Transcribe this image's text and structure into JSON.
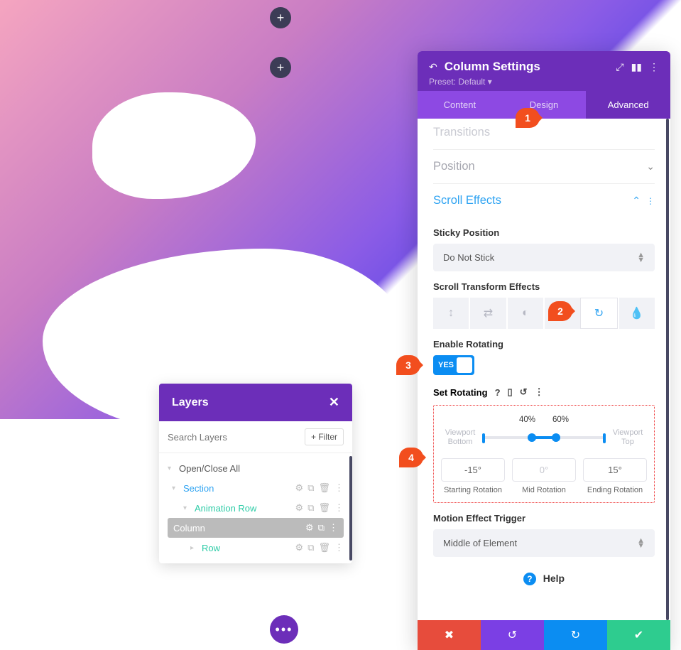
{
  "canvas": {
    "add_button": "+"
  },
  "layers": {
    "title": "Layers",
    "close": "✕",
    "search_placeholder": "Search Layers",
    "filter_label": "+ Filter",
    "open_close_all": "Open/Close All",
    "items": [
      {
        "label": "Section",
        "level": 1,
        "color": "blue"
      },
      {
        "label": "Animation Row",
        "level": 2,
        "color": "teal"
      },
      {
        "label": "Column",
        "level": 3,
        "color": "active"
      },
      {
        "label": "Row",
        "level": 3,
        "color": "teal"
      }
    ]
  },
  "settings": {
    "back": "↶",
    "title": "Column Settings",
    "preset_label": "Preset: Default",
    "preset_caret": "▾",
    "header_icons": {
      "expand": "⤢",
      "page": "▮▮",
      "more": "⋮"
    },
    "tabs": {
      "content": "Content",
      "design": "Design",
      "advanced": "Advanced",
      "active": "advanced"
    },
    "sections": {
      "transitions": "Transitions",
      "position": "Position",
      "scroll_effects": "Scroll Effects"
    },
    "sticky": {
      "label": "Sticky Position",
      "value": "Do Not Stick"
    },
    "transform": {
      "label": "Scroll Transform Effects",
      "icons": {
        "vertical": "↕",
        "horizontal": "⇄",
        "fade": "◐",
        "scale": "⤢",
        "rotate": "↻",
        "blur": "💧"
      }
    },
    "enable_rotating": {
      "label": "Enable Rotating",
      "toggle": "YES"
    },
    "set_rotating": {
      "label": "Set Rotating",
      "icons": {
        "help": "?",
        "device": "▯",
        "reset": "↺",
        "more": "⋮"
      },
      "viewport_bottom": "Viewport Bottom",
      "viewport_top": "Viewport Top",
      "percent_left": "40%",
      "percent_right": "60%",
      "values": {
        "start": {
          "deg": "-15°",
          "cap": "Starting Rotation"
        },
        "mid": {
          "deg": "0°",
          "cap": "Mid Rotation"
        },
        "end": {
          "deg": "15°",
          "cap": "Ending Rotation"
        }
      }
    },
    "motion_trigger": {
      "label": "Motion Effect Trigger",
      "value": "Middle of Element"
    },
    "help": "Help",
    "footer": {
      "cancel": "✖",
      "undo": "↺",
      "redo": "↻",
      "ok": "✔"
    }
  },
  "callouts": {
    "c1": "1",
    "c2": "2",
    "c3": "3",
    "c4": "4"
  }
}
